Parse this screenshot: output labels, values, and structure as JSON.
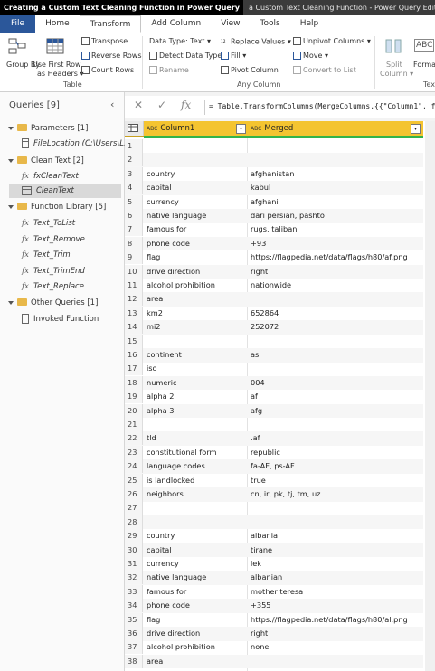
{
  "window": {
    "video_title": "Creating a Custom Text Cleaning Function in Power Query",
    "app_title": "a Custom Text Cleaning Function - Power Query Editor"
  },
  "tabs": [
    "File",
    "Home",
    "Transform",
    "Add Column",
    "View",
    "Tools",
    "Help"
  ],
  "ribbon": {
    "group_by": "Group By",
    "use_first_row": "Use First Row",
    "as_headers": "as Headers ▾",
    "transpose": "Transpose",
    "reverse_rows": "Reverse Rows",
    "count_rows": "Count Rows",
    "table_group": "Table",
    "data_type": "Data Type: Text ▾",
    "detect_data_type": "Detect Data Type",
    "rename": "Rename",
    "replace_values": "Replace Values ▾",
    "fill": "Fill ▾",
    "pivot_column": "Pivot Column",
    "unpivot_columns": "Unpivot Columns ▾",
    "move": "Move ▾",
    "convert_to_list": "Convert to List",
    "any_column_group": "Any Column",
    "split_column": "Split",
    "split_column_2": "Column ▾",
    "format": "Forma",
    "text_group": "Tex"
  },
  "queries": {
    "header": "Queries [9]",
    "items": [
      {
        "label": "Parameters [1]",
        "kind": "folder"
      },
      {
        "label": "FileLocation (C:\\Users\\L...",
        "kind": "param"
      },
      {
        "label": "Clean Text [2]",
        "kind": "folder"
      },
      {
        "label": "fxCleanText",
        "kind": "fx"
      },
      {
        "label": "CleanText",
        "kind": "table"
      },
      {
        "label": "Function Library [5]",
        "kind": "folder"
      },
      {
        "label": "Text_ToList",
        "kind": "fx"
      },
      {
        "label": "Text_Remove",
        "kind": "fx"
      },
      {
        "label": "Text_Trim",
        "kind": "fx"
      },
      {
        "label": "Text_TrimEnd",
        "kind": "fx"
      },
      {
        "label": "Text_Replace",
        "kind": "fx"
      },
      {
        "label": "Other Queries [1]",
        "kind": "folder"
      },
      {
        "label": "Invoked Function",
        "kind": "table"
      }
    ]
  },
  "formula": "= Table.TransformColumns(MergeColumns,{{\"Column1\", fxC",
  "grid": {
    "col1_header": "Column1",
    "col2_header": "Merged",
    "type_badge": "ABC",
    "rows": [
      [
        "1",
        "",
        ""
      ],
      [
        "2",
        "",
        ""
      ],
      [
        "3",
        "country",
        "afghanistan"
      ],
      [
        "4",
        "capital",
        "kabul"
      ],
      [
        "5",
        "currency",
        "afghani"
      ],
      [
        "6",
        "native language",
        "dari persian, pashto"
      ],
      [
        "7",
        "famous for",
        "rugs, taliban"
      ],
      [
        "8",
        "phone code",
        "+93"
      ],
      [
        "9",
        "flag",
        "https://flagpedia.net/data/flags/h80/af.png"
      ],
      [
        "10",
        "drive direction",
        "right"
      ],
      [
        "11",
        "alcohol prohibition",
        "nationwide"
      ],
      [
        "12",
        "area",
        ""
      ],
      [
        "13",
        "km2",
        "652864"
      ],
      [
        "14",
        "mi2",
        "252072"
      ],
      [
        "15",
        "",
        ""
      ],
      [
        "16",
        "continent",
        "as"
      ],
      [
        "17",
        "iso",
        ""
      ],
      [
        "18",
        "numeric",
        "004"
      ],
      [
        "19",
        "alpha 2",
        "af"
      ],
      [
        "20",
        "alpha 3",
        "afg"
      ],
      [
        "21",
        "",
        ""
      ],
      [
        "22",
        "tld",
        ".af"
      ],
      [
        "23",
        "constitutional form",
        "republic"
      ],
      [
        "24",
        "language codes",
        "fa-AF, ps-AF"
      ],
      [
        "25",
        "is landlocked",
        "true"
      ],
      [
        "26",
        "neighbors",
        "cn, ir, pk, tj, tm, uz"
      ],
      [
        "27",
        "",
        ""
      ],
      [
        "28",
        "",
        ""
      ],
      [
        "29",
        "country",
        "albania"
      ],
      [
        "30",
        "capital",
        "tirane"
      ],
      [
        "31",
        "currency",
        "lek"
      ],
      [
        "32",
        "native language",
        "albanian"
      ],
      [
        "33",
        "famous for",
        "mother teresa"
      ],
      [
        "34",
        "phone code",
        "+355"
      ],
      [
        "35",
        "flag",
        "https://flagpedia.net/data/flags/h80/al.png"
      ],
      [
        "36",
        "drive direction",
        "right"
      ],
      [
        "37",
        "alcohol prohibition",
        "none"
      ],
      [
        "38",
        "area",
        ""
      ]
    ]
  }
}
